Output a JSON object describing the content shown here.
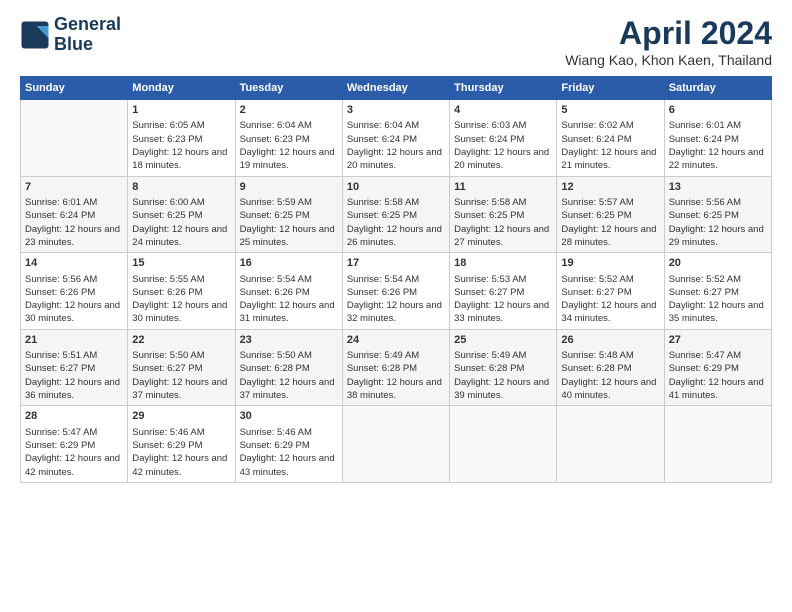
{
  "header": {
    "logo_line1": "General",
    "logo_line2": "Blue",
    "title": "April 2024",
    "subtitle": "Wiang Kao, Khon Kaen, Thailand"
  },
  "days_of_week": [
    "Sunday",
    "Monday",
    "Tuesday",
    "Wednesday",
    "Thursday",
    "Friday",
    "Saturday"
  ],
  "weeks": [
    [
      {
        "day": "",
        "sunrise": "",
        "sunset": "",
        "daylight": ""
      },
      {
        "day": "1",
        "sunrise": "Sunrise: 6:05 AM",
        "sunset": "Sunset: 6:23 PM",
        "daylight": "Daylight: 12 hours and 18 minutes."
      },
      {
        "day": "2",
        "sunrise": "Sunrise: 6:04 AM",
        "sunset": "Sunset: 6:23 PM",
        "daylight": "Daylight: 12 hours and 19 minutes."
      },
      {
        "day": "3",
        "sunrise": "Sunrise: 6:04 AM",
        "sunset": "Sunset: 6:24 PM",
        "daylight": "Daylight: 12 hours and 20 minutes."
      },
      {
        "day": "4",
        "sunrise": "Sunrise: 6:03 AM",
        "sunset": "Sunset: 6:24 PM",
        "daylight": "Daylight: 12 hours and 20 minutes."
      },
      {
        "day": "5",
        "sunrise": "Sunrise: 6:02 AM",
        "sunset": "Sunset: 6:24 PM",
        "daylight": "Daylight: 12 hours and 21 minutes."
      },
      {
        "day": "6",
        "sunrise": "Sunrise: 6:01 AM",
        "sunset": "Sunset: 6:24 PM",
        "daylight": "Daylight: 12 hours and 22 minutes."
      }
    ],
    [
      {
        "day": "7",
        "sunrise": "Sunrise: 6:01 AM",
        "sunset": "Sunset: 6:24 PM",
        "daylight": "Daylight: 12 hours and 23 minutes."
      },
      {
        "day": "8",
        "sunrise": "Sunrise: 6:00 AM",
        "sunset": "Sunset: 6:25 PM",
        "daylight": "Daylight: 12 hours and 24 minutes."
      },
      {
        "day": "9",
        "sunrise": "Sunrise: 5:59 AM",
        "sunset": "Sunset: 6:25 PM",
        "daylight": "Daylight: 12 hours and 25 minutes."
      },
      {
        "day": "10",
        "sunrise": "Sunrise: 5:58 AM",
        "sunset": "Sunset: 6:25 PM",
        "daylight": "Daylight: 12 hours and 26 minutes."
      },
      {
        "day": "11",
        "sunrise": "Sunrise: 5:58 AM",
        "sunset": "Sunset: 6:25 PM",
        "daylight": "Daylight: 12 hours and 27 minutes."
      },
      {
        "day": "12",
        "sunrise": "Sunrise: 5:57 AM",
        "sunset": "Sunset: 6:25 PM",
        "daylight": "Daylight: 12 hours and 28 minutes."
      },
      {
        "day": "13",
        "sunrise": "Sunrise: 5:56 AM",
        "sunset": "Sunset: 6:25 PM",
        "daylight": "Daylight: 12 hours and 29 minutes."
      }
    ],
    [
      {
        "day": "14",
        "sunrise": "Sunrise: 5:56 AM",
        "sunset": "Sunset: 6:26 PM",
        "daylight": "Daylight: 12 hours and 30 minutes."
      },
      {
        "day": "15",
        "sunrise": "Sunrise: 5:55 AM",
        "sunset": "Sunset: 6:26 PM",
        "daylight": "Daylight: 12 hours and 30 minutes."
      },
      {
        "day": "16",
        "sunrise": "Sunrise: 5:54 AM",
        "sunset": "Sunset: 6:26 PM",
        "daylight": "Daylight: 12 hours and 31 minutes."
      },
      {
        "day": "17",
        "sunrise": "Sunrise: 5:54 AM",
        "sunset": "Sunset: 6:26 PM",
        "daylight": "Daylight: 12 hours and 32 minutes."
      },
      {
        "day": "18",
        "sunrise": "Sunrise: 5:53 AM",
        "sunset": "Sunset: 6:27 PM",
        "daylight": "Daylight: 12 hours and 33 minutes."
      },
      {
        "day": "19",
        "sunrise": "Sunrise: 5:52 AM",
        "sunset": "Sunset: 6:27 PM",
        "daylight": "Daylight: 12 hours and 34 minutes."
      },
      {
        "day": "20",
        "sunrise": "Sunrise: 5:52 AM",
        "sunset": "Sunset: 6:27 PM",
        "daylight": "Daylight: 12 hours and 35 minutes."
      }
    ],
    [
      {
        "day": "21",
        "sunrise": "Sunrise: 5:51 AM",
        "sunset": "Sunset: 6:27 PM",
        "daylight": "Daylight: 12 hours and 36 minutes."
      },
      {
        "day": "22",
        "sunrise": "Sunrise: 5:50 AM",
        "sunset": "Sunset: 6:27 PM",
        "daylight": "Daylight: 12 hours and 37 minutes."
      },
      {
        "day": "23",
        "sunrise": "Sunrise: 5:50 AM",
        "sunset": "Sunset: 6:28 PM",
        "daylight": "Daylight: 12 hours and 37 minutes."
      },
      {
        "day": "24",
        "sunrise": "Sunrise: 5:49 AM",
        "sunset": "Sunset: 6:28 PM",
        "daylight": "Daylight: 12 hours and 38 minutes."
      },
      {
        "day": "25",
        "sunrise": "Sunrise: 5:49 AM",
        "sunset": "Sunset: 6:28 PM",
        "daylight": "Daylight: 12 hours and 39 minutes."
      },
      {
        "day": "26",
        "sunrise": "Sunrise: 5:48 AM",
        "sunset": "Sunset: 6:28 PM",
        "daylight": "Daylight: 12 hours and 40 minutes."
      },
      {
        "day": "27",
        "sunrise": "Sunrise: 5:47 AM",
        "sunset": "Sunset: 6:29 PM",
        "daylight": "Daylight: 12 hours and 41 minutes."
      }
    ],
    [
      {
        "day": "28",
        "sunrise": "Sunrise: 5:47 AM",
        "sunset": "Sunset: 6:29 PM",
        "daylight": "Daylight: 12 hours and 42 minutes."
      },
      {
        "day": "29",
        "sunrise": "Sunrise: 5:46 AM",
        "sunset": "Sunset: 6:29 PM",
        "daylight": "Daylight: 12 hours and 42 minutes."
      },
      {
        "day": "30",
        "sunrise": "Sunrise: 5:46 AM",
        "sunset": "Sunset: 6:29 PM",
        "daylight": "Daylight: 12 hours and 43 minutes."
      },
      {
        "day": "",
        "sunrise": "",
        "sunset": "",
        "daylight": ""
      },
      {
        "day": "",
        "sunrise": "",
        "sunset": "",
        "daylight": ""
      },
      {
        "day": "",
        "sunrise": "",
        "sunset": "",
        "daylight": ""
      },
      {
        "day": "",
        "sunrise": "",
        "sunset": "",
        "daylight": ""
      }
    ]
  ]
}
